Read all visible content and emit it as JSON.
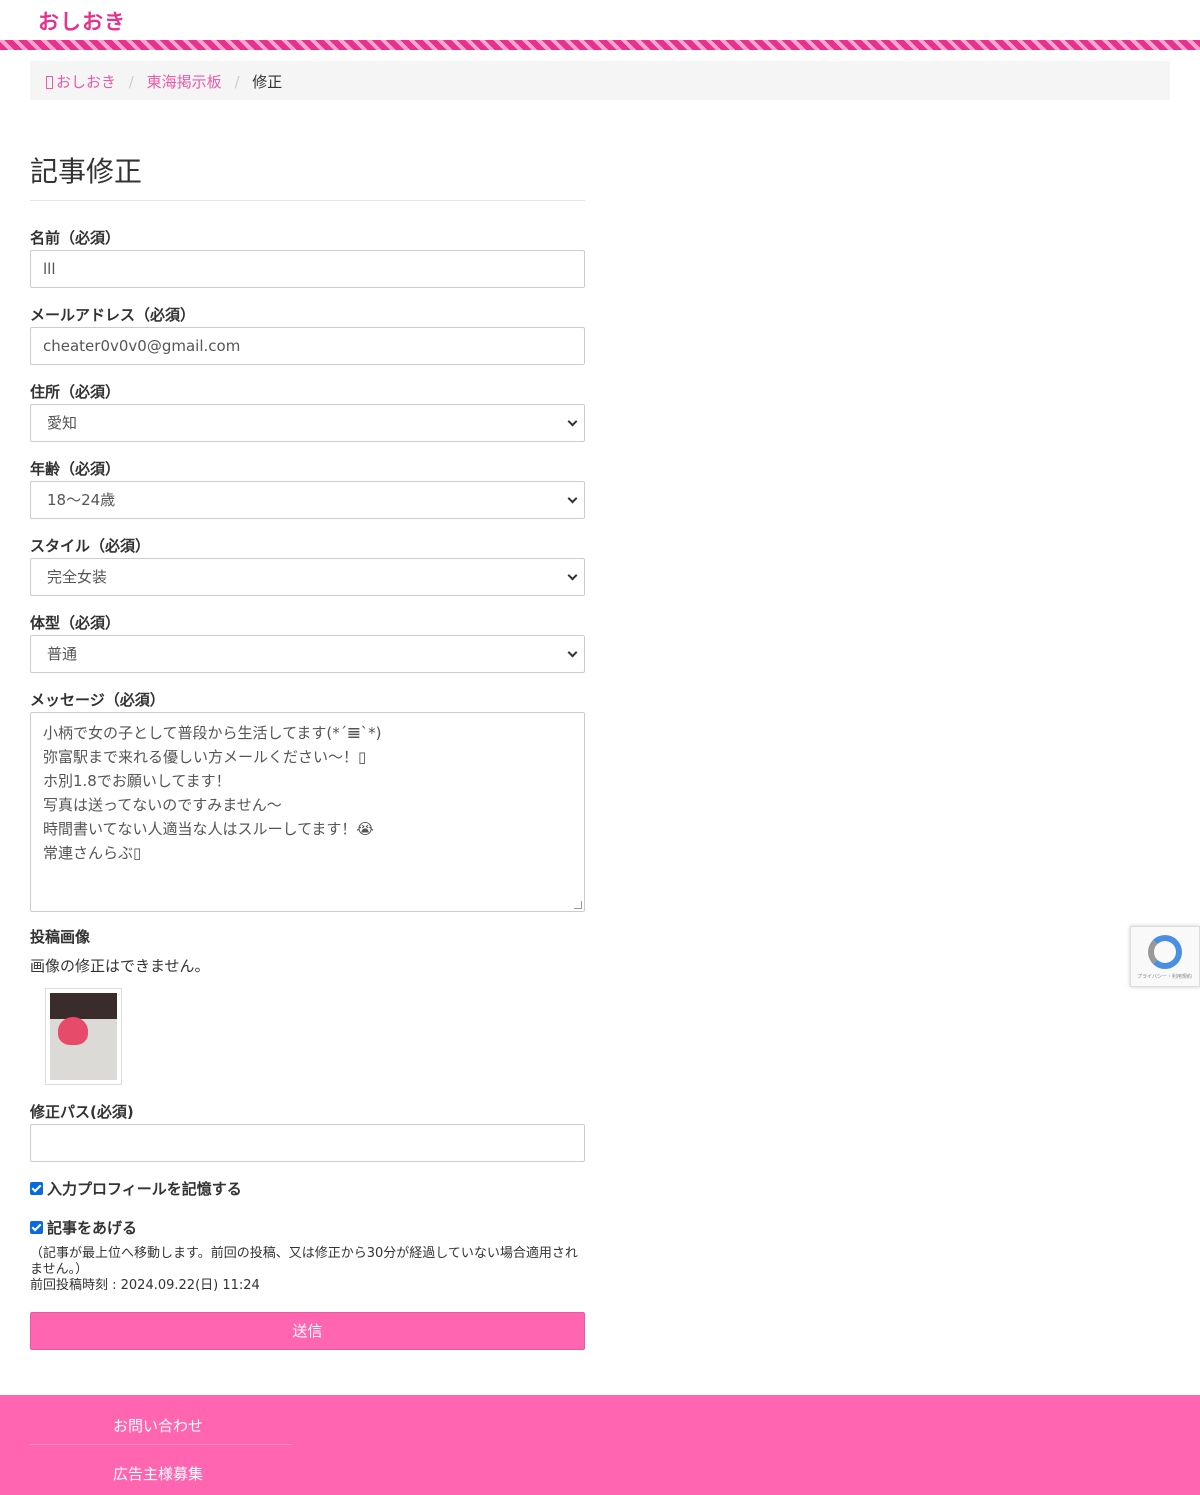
{
  "site": {
    "logo": "おしおき"
  },
  "breadcrumb": {
    "home": "おしおき",
    "board": "東海掲示板",
    "current": "修正"
  },
  "form": {
    "heading": "記事修正",
    "name_label": "名前（必須）",
    "name_value": "lll",
    "email_label": "メールアドレス（必須）",
    "email_value": "cheater0v0v0@gmail.com",
    "address_label": "住所（必須）",
    "address_value": "愛知",
    "age_label": "年齢（必須）",
    "age_value": "18〜24歳",
    "style_label": "スタイル（必須）",
    "style_value": "完全女装",
    "body_label": "体型（必須）",
    "body_value": "普通",
    "message_label": "メッセージ（必須）",
    "message_lines": [
      "小柄で女の子として普段から生活してます(*´𝌆`*)",
      "弥富駅まで来れる優しい方メールください〜！▯",
      "ホ別1.8でお願いしてます！",
      "写真は送ってないのですみません〜",
      "時間書いてない人適当な人はスルーしてます！😭",
      "常連さんらぶ▯"
    ],
    "image_label": "投稿画像",
    "image_note": "画像の修正はできません。",
    "pass_label": "修正パス(必須)",
    "pass_value": "",
    "remember_label": "入力プロフィールを記憶する",
    "raise_label": "記事をあげる",
    "raise_note": "（記事が最上位へ移動します。前回の投稿、又は修正から30分が経過していない場合適用されません。）",
    "last_post": "前回投稿時刻 : 2024.09.22(日) 11:24",
    "submit_label": "送信"
  },
  "recaptcha": {
    "text": "プライバシー・利用規約"
  },
  "footer": {
    "contact": "お問い合わせ",
    "ads": "広告主様募集"
  },
  "colors": {
    "accent": "#e8318f",
    "button": "#ff65b0",
    "footer": "#ff65b0",
    "link": "#ef5aa6"
  }
}
